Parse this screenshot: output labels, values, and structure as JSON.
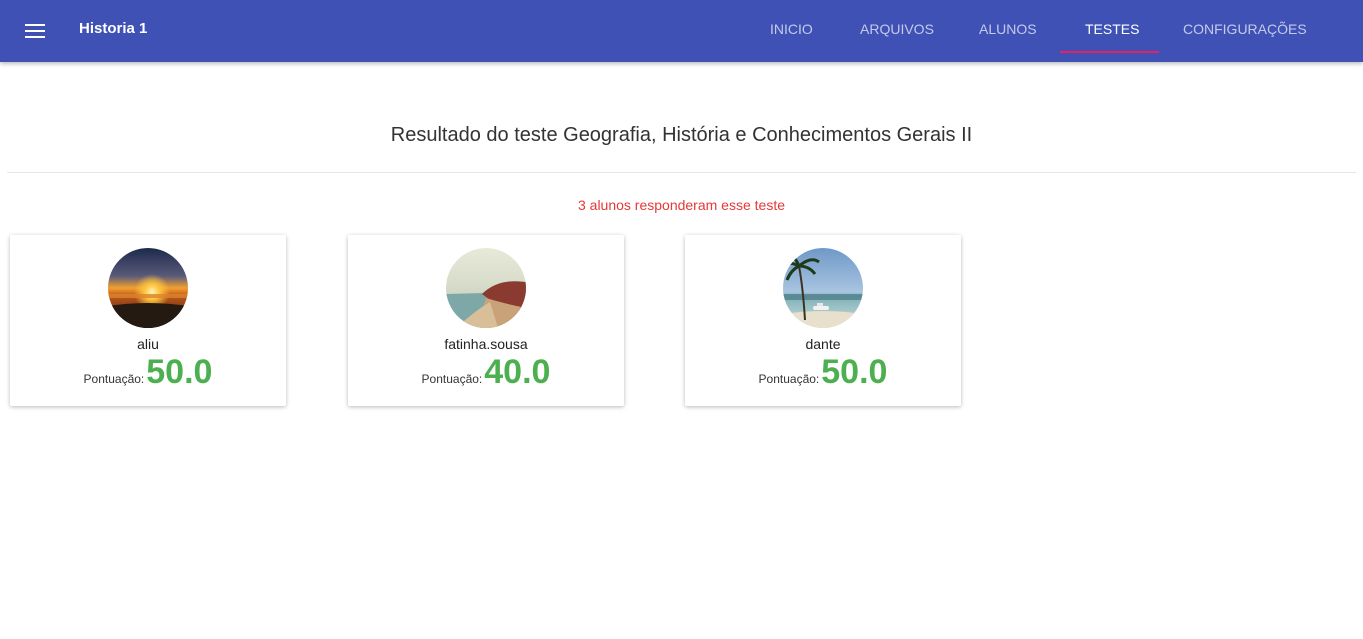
{
  "toolbar": {
    "menu_icon": "menu-icon",
    "title": "Historia 1",
    "tabs": [
      {
        "label": "INICIO",
        "active": false
      },
      {
        "label": "ARQUIVOS",
        "active": false
      },
      {
        "label": "ALUNOS",
        "active": false
      },
      {
        "label": "TESTES",
        "active": true
      },
      {
        "label": "CONFIGURAÇÕES",
        "active": false
      }
    ],
    "colors": {
      "background": "#3f51b5",
      "indicator": "#e91e63"
    }
  },
  "main": {
    "title": "Resultado do teste Geografia, História e Conhecimentos Gerais II",
    "respondents_text": "3 alunos responderam esse teste",
    "students": [
      {
        "name": "aliu",
        "score_label": "Pontuação:",
        "score": "50.0",
        "avatar": "sunset-photo"
      },
      {
        "name": "fatinha.sousa",
        "score_label": "Pontuação:",
        "score": "40.0",
        "avatar": "coast-photo"
      },
      {
        "name": "dante",
        "score_label": "Pontuação:",
        "score": "50.0",
        "avatar": "palm-beach-photo"
      }
    ],
    "colors": {
      "score": "#4caf50",
      "respondents": "#e53935"
    }
  }
}
